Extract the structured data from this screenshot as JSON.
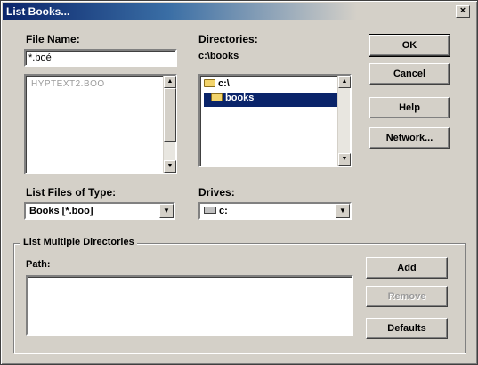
{
  "window": {
    "title": "List Books...",
    "close_glyph": "×"
  },
  "file_name": {
    "label": "File Name:",
    "value": "*.boé"
  },
  "file_list": {
    "items": [
      "HYPTEXT2.BOO"
    ]
  },
  "directories": {
    "label": "Directories:",
    "current_path": "c:\\books",
    "tree": [
      {
        "label": "c:\\",
        "icon": "open-folder-icon",
        "selected": false
      },
      {
        "label": "books",
        "icon": "open-folder-icon",
        "selected": true
      }
    ]
  },
  "file_type": {
    "label": "List Files of Type:",
    "value": "Books [*.boo]"
  },
  "drives": {
    "label": "Drives:",
    "value": "c:"
  },
  "buttons": {
    "ok": "OK",
    "cancel": "Cancel",
    "help": "Help",
    "network": "Network...",
    "add": "Add",
    "remove": "Remove",
    "defaults": "Defaults"
  },
  "multiple_dirs": {
    "legend": "List Multiple Directories",
    "path_label": "Path:",
    "path_value": ""
  },
  "scroll_glyphs": {
    "up": "▲",
    "down": "▼"
  },
  "colors": {
    "selection": "#0a246a",
    "face": "#d4d0c8",
    "title_start": "#0a246a"
  }
}
